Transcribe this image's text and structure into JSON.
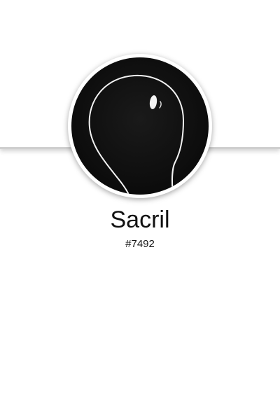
{
  "profile": {
    "username": "Sacril",
    "discriminator": "#7492",
    "avatar_icon": "dark-figure-avatar"
  },
  "colors": {
    "background": "#ffffff",
    "header_border": "#cfcfcf",
    "avatar_bg": "#0e0e0e",
    "avatar_line": "#ffffff",
    "text": "#111111"
  }
}
